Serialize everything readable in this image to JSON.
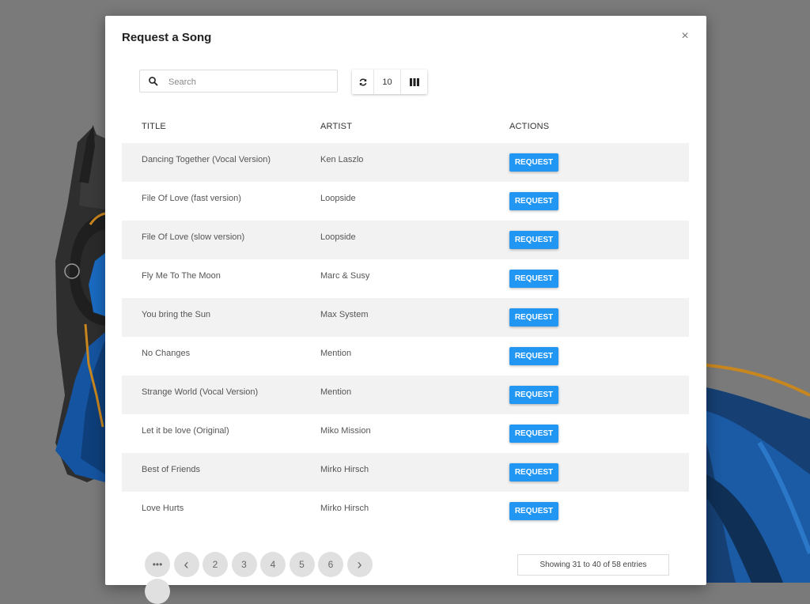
{
  "modal": {
    "title": "Request a Song",
    "close_label": "×"
  },
  "toolbar": {
    "search_placeholder": "Search",
    "page_size": "10"
  },
  "table": {
    "headers": {
      "title": "TITLE",
      "artist": "ARTIST",
      "actions": "ACTIONS"
    },
    "button_label": "REQUEST",
    "rows": [
      {
        "title": "Dancing Together (Vocal Version)",
        "artist": "Ken Laszlo"
      },
      {
        "title": "File Of Love (fast version)",
        "artist": "Loopside"
      },
      {
        "title": "File Of Love (slow version)",
        "artist": "Loopside"
      },
      {
        "title": "Fly Me To The Moon",
        "artist": "Marc & Susy"
      },
      {
        "title": "You bring the Sun",
        "artist": "Max System"
      },
      {
        "title": "No Changes",
        "artist": "Mention"
      },
      {
        "title": "Strange World (Vocal Version)",
        "artist": "Mention"
      },
      {
        "title": "Let it be love (Original)",
        "artist": "Miko Mission"
      },
      {
        "title": "Best of Friends",
        "artist": "Mirko Hirsch"
      },
      {
        "title": "Love Hurts",
        "artist": "Mirko Hirsch"
      }
    ]
  },
  "pagination": {
    "ellipsis": "•••",
    "prev": "‹",
    "next": "›",
    "pages": [
      "2",
      "3",
      "4",
      "5",
      "6"
    ]
  },
  "status": {
    "entries_text": "Showing 31 to 40 of 58 entries"
  },
  "colors": {
    "accent": "#2196f3",
    "overlay": "#7a7a7a"
  }
}
